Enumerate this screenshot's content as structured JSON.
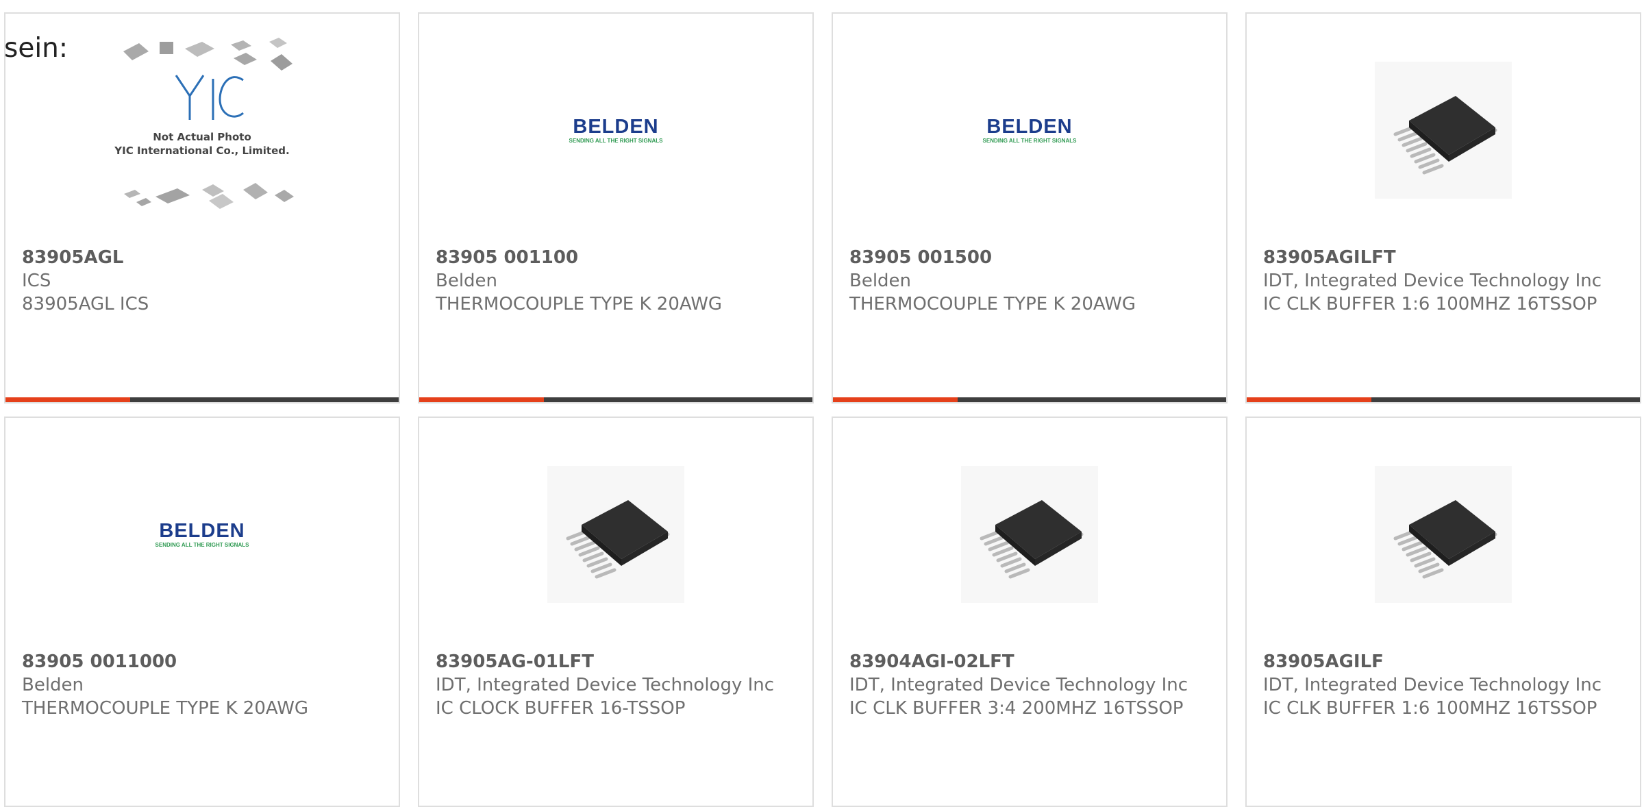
{
  "lead_text": "sein:",
  "colors": {
    "accent": "#e5401a",
    "bar": "#3e3e3e",
    "border": "#dedede",
    "part_text": "#5d5d5d",
    "body_text": "#6f6f6f"
  },
  "products": [
    {
      "part": "83905AGL",
      "manufacturer": "ICS",
      "description": "83905AGL ICS",
      "image": "yic-placeholder",
      "image_text": {
        "caption_line1": "Not Actual Photo",
        "caption_line2": "YIC International Co., Limited."
      }
    },
    {
      "part": "83905 001100",
      "manufacturer": "Belden",
      "description": "THERMOCOUPLE TYPE K 20AWG",
      "image": "belden-logo",
      "image_text": {
        "logo": "BELDEN",
        "tagline": "SENDING ALL THE RIGHT SIGNALS"
      }
    },
    {
      "part": "83905 001500",
      "manufacturer": "Belden",
      "description": "THERMOCOUPLE TYPE K 20AWG",
      "image": "belden-logo",
      "image_text": {
        "logo": "BELDEN",
        "tagline": "SENDING ALL THE RIGHT SIGNALS"
      }
    },
    {
      "part": "83905AGILFT",
      "manufacturer": "IDT, Integrated Device Technology Inc",
      "description": "IC CLK BUFFER 1:6 100MHZ 16TSSOP",
      "image": "tssop-chip"
    },
    {
      "part": "83905 0011000",
      "manufacturer": "Belden",
      "description": "THERMOCOUPLE TYPE K 20AWG",
      "image": "belden-logo",
      "image_text": {
        "logo": "BELDEN",
        "tagline": "SENDING ALL THE RIGHT SIGNALS"
      }
    },
    {
      "part": "83905AG-01LFT",
      "manufacturer": "IDT, Integrated Device Technology Inc",
      "description": "IC CLOCK BUFFER 16-TSSOP",
      "image": "tssop-chip"
    },
    {
      "part": "83904AGI-02LFT",
      "manufacturer": "IDT, Integrated Device Technology Inc",
      "description": "IC CLK BUFFER 3:4 200MHZ 16TSSOP",
      "image": "tssop-chip"
    },
    {
      "part": "83905AGILF",
      "manufacturer": "IDT, Integrated Device Technology Inc",
      "description": "IC CLK BUFFER 1:6 100MHZ 16TSSOP",
      "image": "tssop-chip"
    }
  ]
}
